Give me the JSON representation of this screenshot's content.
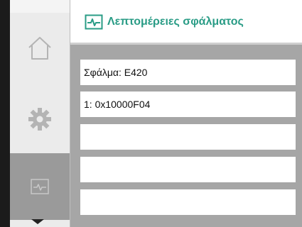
{
  "header": {
    "title": "Λεπτομέρειες σφάλματος",
    "icon": "monitor-pulse-icon",
    "accent_color": "#2a9c86"
  },
  "sidebar": {
    "items": [
      {
        "name": "home",
        "icon": "home-icon",
        "active": false
      },
      {
        "name": "settings",
        "icon": "gear-icon",
        "active": false
      },
      {
        "name": "diagnostics",
        "icon": "monitor-pulse-icon",
        "active": true
      }
    ],
    "scroll_indicator": "chevron-down-icon"
  },
  "details": {
    "rows": [
      "Σφάλμα: E420",
      "1: 0x10000F04",
      "",
      "",
      ""
    ]
  }
}
